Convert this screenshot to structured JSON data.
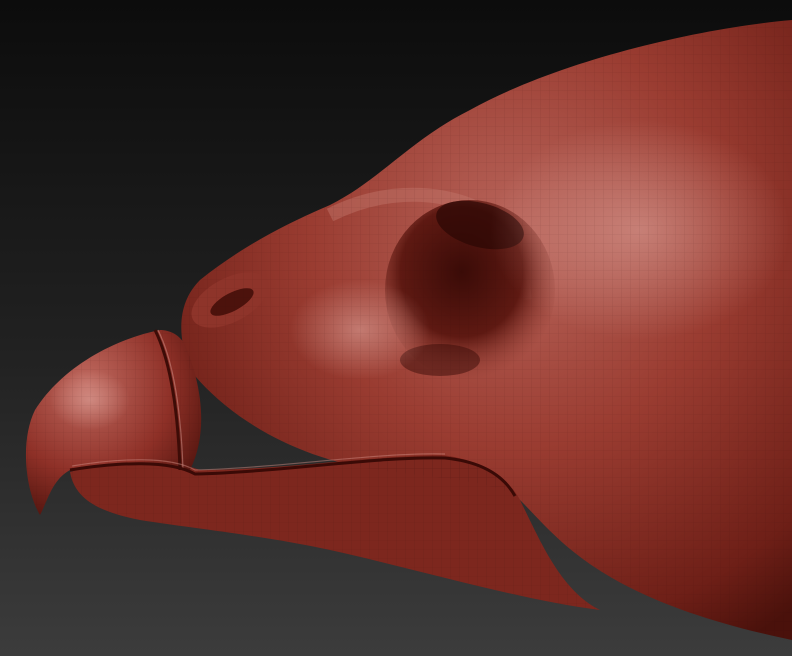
{
  "scene": {
    "subject": "sculpted-bird-head",
    "background_top": "#0e0e0e",
    "background_bottom": "#3b3b3b",
    "material_base": "#8f2f25",
    "material_highlight": "#c98a82",
    "material_shadow": "#3a0c08"
  }
}
